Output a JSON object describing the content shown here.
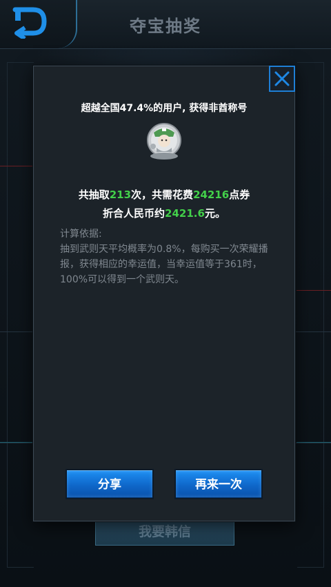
{
  "header": {
    "title": "夺宝抽奖"
  },
  "background": {
    "bottom_button_label": "我要韩信"
  },
  "dialog": {
    "headline": "超越全国47.4%的用户, 获得非酋称号",
    "stats": {
      "line1_prefix": "共抽取",
      "draw_count": "213",
      "line1_mid": "次，共需花费",
      "coupon_cost": "24216",
      "line1_suffix": "点券",
      "line2_prefix": "折合人民币约",
      "rmb_amount": "2421.6",
      "line2_suffix": "元。"
    },
    "basis_title": "计算依据:",
    "basis_text": "抽到武则天平均概率为0.8%，每购买一次荣耀播报，获得相应的幸运值，当幸运值等于361时，100%可以得到一个武则天。",
    "share_label": "分享",
    "again_label": "再来一次"
  },
  "colors": {
    "highlight_green": "#43d04a",
    "button_blue": "#1478e0",
    "close_blue": "#1e7fd6"
  },
  "icons": {
    "back": "back-arrow-icon",
    "close": "close-icon",
    "avatar": "title-badge-avatar"
  }
}
